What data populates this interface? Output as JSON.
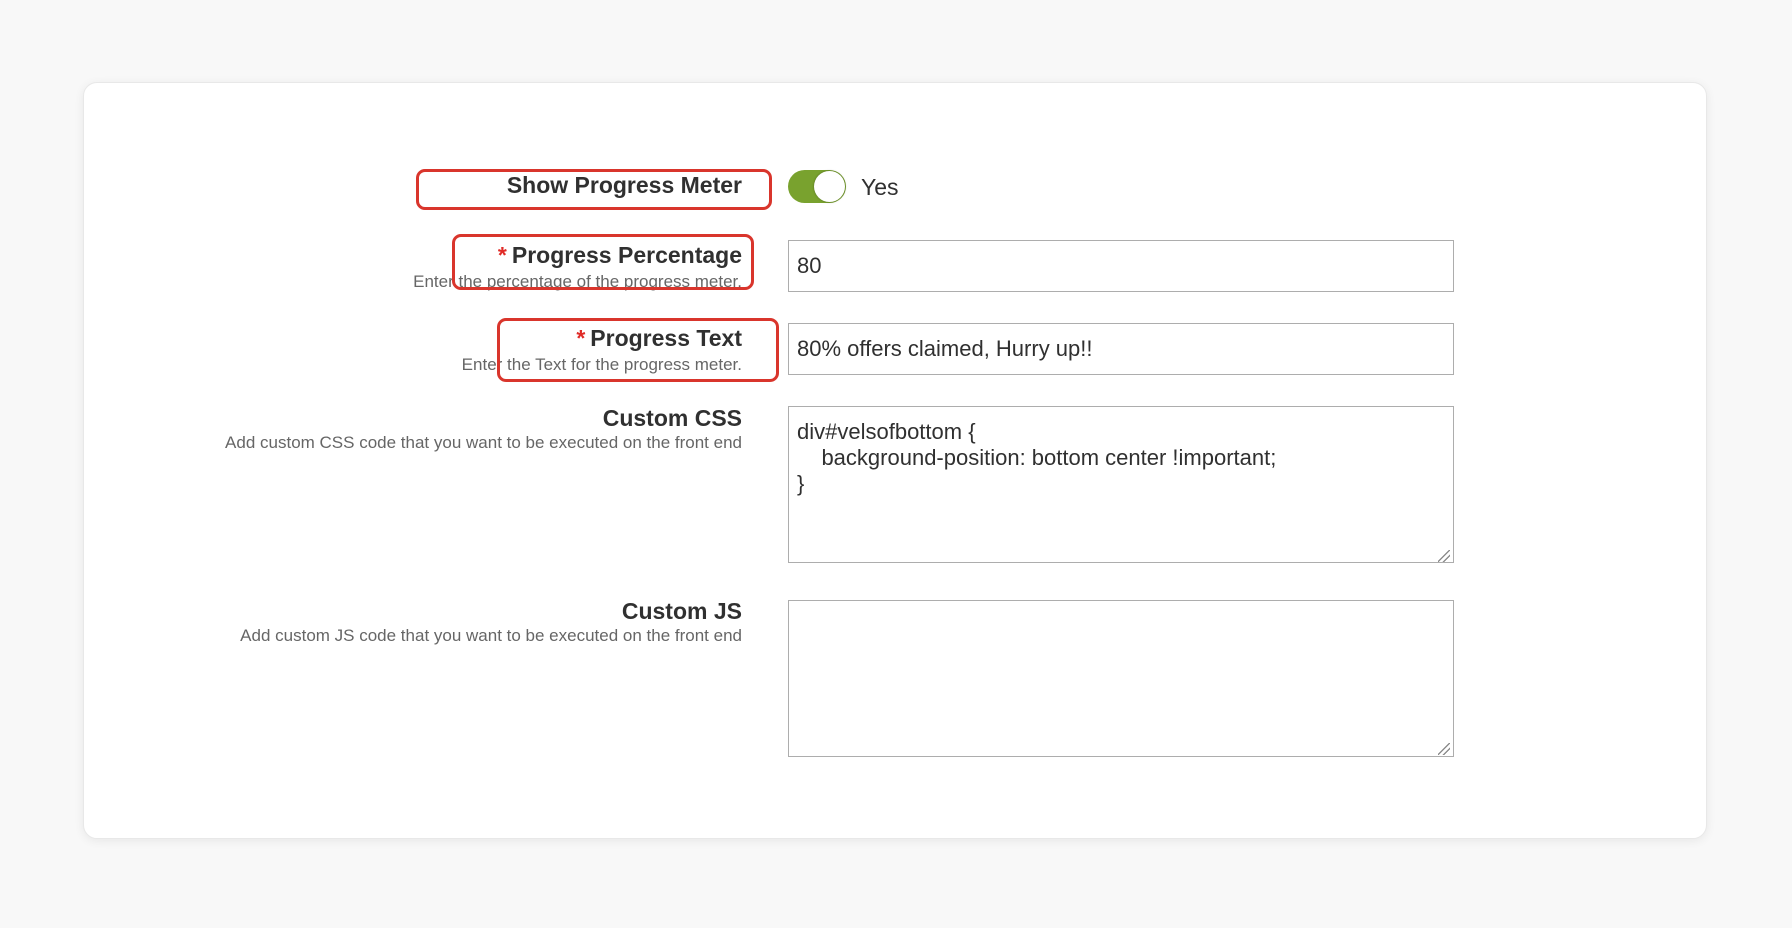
{
  "form": {
    "show_progress_meter": {
      "label": "Show Progress Meter",
      "value": "Yes",
      "enabled": true
    },
    "progress_percentage": {
      "required_mark": "*",
      "label": "Progress Percentage",
      "hint": "Enter the percentage of the progress meter.",
      "value": "80"
    },
    "progress_text": {
      "required_mark": "*",
      "label": "Progress Text",
      "hint": "Enter the Text for the progress meter.",
      "value": "80% offers claimed, Hurry up!!"
    },
    "custom_css": {
      "label": "Custom CSS",
      "hint": "Add custom CSS code that you want to be executed on the front end",
      "value": "div#velsofbottom {\n    background-position: bottom center !important;\n}"
    },
    "custom_js": {
      "label": "Custom JS",
      "hint": "Add custom JS code that you want to be executed on the front end",
      "value": ""
    }
  },
  "colors": {
    "toggle_on": "#79a22e",
    "required": "#e02b27",
    "highlight": "#d9352c"
  }
}
